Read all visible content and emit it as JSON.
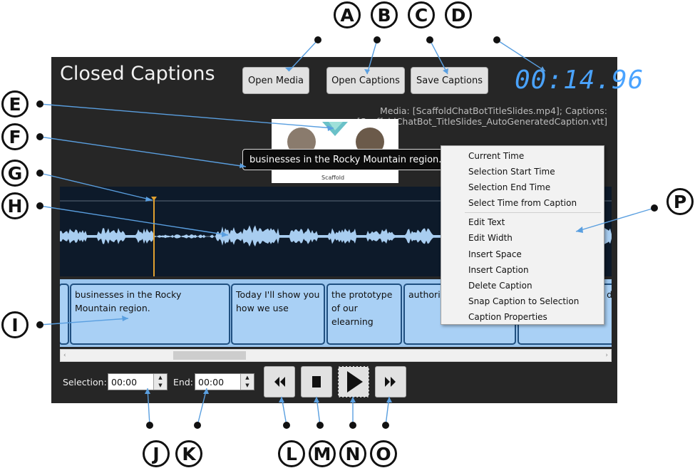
{
  "app": {
    "title": "Closed Captions",
    "clock": "00:14.96"
  },
  "buttons": {
    "open_media": "Open Media",
    "open_captions": "Open Captions",
    "save_captions": "Save Captions"
  },
  "media_info": "Media: [ScaffoldChatBotTitleSlides.mp4]; Captions: [ScaffoldChatBot_TitleSlides_AutoGeneratedCaption.vtt]",
  "preview": {
    "caption_text": "businesses in the Rocky Mountain region.",
    "logo_text": "Scaffold"
  },
  "timeline": {
    "segments": [
      {
        "text": ""
      },
      {
        "text": "businesses in the Rocky Mountain region."
      },
      {
        "text": "Today I'll show you how we use"
      },
      {
        "text": "the prototype of our elearning"
      },
      {
        "text": "authoring to design"
      },
      {
        "text": "d"
      }
    ]
  },
  "controls": {
    "selection_label": "Selection:",
    "selection_value": "00:00",
    "end_label": "End:",
    "end_value": "00:00"
  },
  "context_menu": {
    "group1": [
      "Current Time",
      "Selection Start Time",
      "Selection End Time",
      "Select Time from Caption"
    ],
    "group2": [
      "Edit Text",
      "Edit Width",
      "Insert Space",
      "Insert Caption",
      "Delete Caption",
      "Snap Caption to Selection",
      "Caption Properties"
    ]
  },
  "callouts": [
    "A",
    "B",
    "C",
    "D",
    "E",
    "F",
    "G",
    "H",
    "I",
    "J",
    "K",
    "L",
    "M",
    "N",
    "O",
    "P"
  ],
  "colors": {
    "panel": "#262626",
    "accent_blue": "#4aa3ff",
    "caption_track": "#a9d0f5",
    "waveform": "#a8cdf0",
    "playhead": "#e0a030"
  },
  "icons": {
    "rewind": "rewind-icon",
    "stop": "stop-icon",
    "play": "play-icon",
    "fast_forward": "fast-forward-icon"
  }
}
